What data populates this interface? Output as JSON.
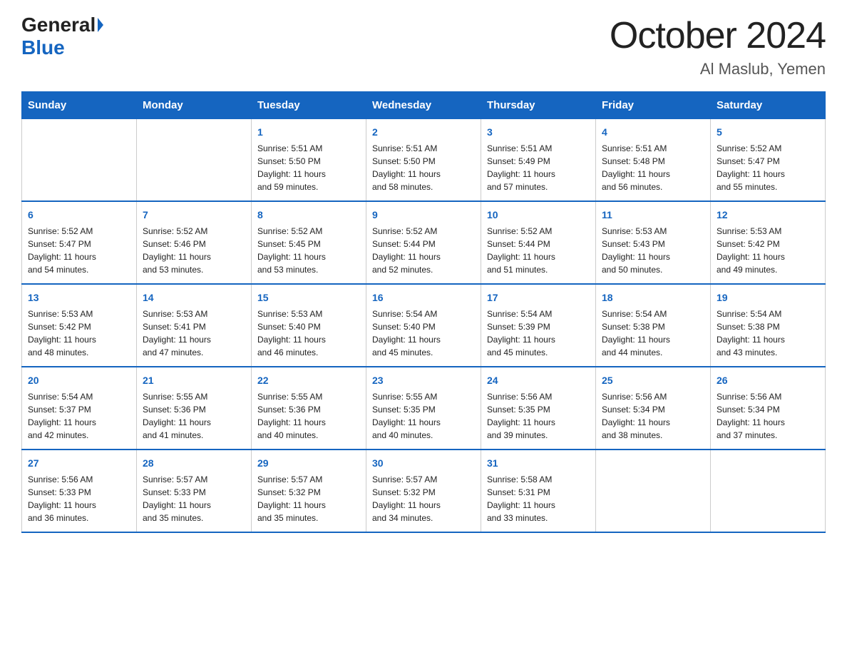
{
  "header": {
    "logo_general": "General",
    "logo_blue": "Blue",
    "title": "October 2024",
    "subtitle": "Al Maslub, Yemen"
  },
  "weekdays": [
    "Sunday",
    "Monday",
    "Tuesday",
    "Wednesday",
    "Thursday",
    "Friday",
    "Saturday"
  ],
  "weeks": [
    [
      {
        "day": "",
        "info": ""
      },
      {
        "day": "",
        "info": ""
      },
      {
        "day": "1",
        "info": "Sunrise: 5:51 AM\nSunset: 5:50 PM\nDaylight: 11 hours\nand 59 minutes."
      },
      {
        "day": "2",
        "info": "Sunrise: 5:51 AM\nSunset: 5:50 PM\nDaylight: 11 hours\nand 58 minutes."
      },
      {
        "day": "3",
        "info": "Sunrise: 5:51 AM\nSunset: 5:49 PM\nDaylight: 11 hours\nand 57 minutes."
      },
      {
        "day": "4",
        "info": "Sunrise: 5:51 AM\nSunset: 5:48 PM\nDaylight: 11 hours\nand 56 minutes."
      },
      {
        "day": "5",
        "info": "Sunrise: 5:52 AM\nSunset: 5:47 PM\nDaylight: 11 hours\nand 55 minutes."
      }
    ],
    [
      {
        "day": "6",
        "info": "Sunrise: 5:52 AM\nSunset: 5:47 PM\nDaylight: 11 hours\nand 54 minutes."
      },
      {
        "day": "7",
        "info": "Sunrise: 5:52 AM\nSunset: 5:46 PM\nDaylight: 11 hours\nand 53 minutes."
      },
      {
        "day": "8",
        "info": "Sunrise: 5:52 AM\nSunset: 5:45 PM\nDaylight: 11 hours\nand 53 minutes."
      },
      {
        "day": "9",
        "info": "Sunrise: 5:52 AM\nSunset: 5:44 PM\nDaylight: 11 hours\nand 52 minutes."
      },
      {
        "day": "10",
        "info": "Sunrise: 5:52 AM\nSunset: 5:44 PM\nDaylight: 11 hours\nand 51 minutes."
      },
      {
        "day": "11",
        "info": "Sunrise: 5:53 AM\nSunset: 5:43 PM\nDaylight: 11 hours\nand 50 minutes."
      },
      {
        "day": "12",
        "info": "Sunrise: 5:53 AM\nSunset: 5:42 PM\nDaylight: 11 hours\nand 49 minutes."
      }
    ],
    [
      {
        "day": "13",
        "info": "Sunrise: 5:53 AM\nSunset: 5:42 PM\nDaylight: 11 hours\nand 48 minutes."
      },
      {
        "day": "14",
        "info": "Sunrise: 5:53 AM\nSunset: 5:41 PM\nDaylight: 11 hours\nand 47 minutes."
      },
      {
        "day": "15",
        "info": "Sunrise: 5:53 AM\nSunset: 5:40 PM\nDaylight: 11 hours\nand 46 minutes."
      },
      {
        "day": "16",
        "info": "Sunrise: 5:54 AM\nSunset: 5:40 PM\nDaylight: 11 hours\nand 45 minutes."
      },
      {
        "day": "17",
        "info": "Sunrise: 5:54 AM\nSunset: 5:39 PM\nDaylight: 11 hours\nand 45 minutes."
      },
      {
        "day": "18",
        "info": "Sunrise: 5:54 AM\nSunset: 5:38 PM\nDaylight: 11 hours\nand 44 minutes."
      },
      {
        "day": "19",
        "info": "Sunrise: 5:54 AM\nSunset: 5:38 PM\nDaylight: 11 hours\nand 43 minutes."
      }
    ],
    [
      {
        "day": "20",
        "info": "Sunrise: 5:54 AM\nSunset: 5:37 PM\nDaylight: 11 hours\nand 42 minutes."
      },
      {
        "day": "21",
        "info": "Sunrise: 5:55 AM\nSunset: 5:36 PM\nDaylight: 11 hours\nand 41 minutes."
      },
      {
        "day": "22",
        "info": "Sunrise: 5:55 AM\nSunset: 5:36 PM\nDaylight: 11 hours\nand 40 minutes."
      },
      {
        "day": "23",
        "info": "Sunrise: 5:55 AM\nSunset: 5:35 PM\nDaylight: 11 hours\nand 40 minutes."
      },
      {
        "day": "24",
        "info": "Sunrise: 5:56 AM\nSunset: 5:35 PM\nDaylight: 11 hours\nand 39 minutes."
      },
      {
        "day": "25",
        "info": "Sunrise: 5:56 AM\nSunset: 5:34 PM\nDaylight: 11 hours\nand 38 minutes."
      },
      {
        "day": "26",
        "info": "Sunrise: 5:56 AM\nSunset: 5:34 PM\nDaylight: 11 hours\nand 37 minutes."
      }
    ],
    [
      {
        "day": "27",
        "info": "Sunrise: 5:56 AM\nSunset: 5:33 PM\nDaylight: 11 hours\nand 36 minutes."
      },
      {
        "day": "28",
        "info": "Sunrise: 5:57 AM\nSunset: 5:33 PM\nDaylight: 11 hours\nand 35 minutes."
      },
      {
        "day": "29",
        "info": "Sunrise: 5:57 AM\nSunset: 5:32 PM\nDaylight: 11 hours\nand 35 minutes."
      },
      {
        "day": "30",
        "info": "Sunrise: 5:57 AM\nSunset: 5:32 PM\nDaylight: 11 hours\nand 34 minutes."
      },
      {
        "day": "31",
        "info": "Sunrise: 5:58 AM\nSunset: 5:31 PM\nDaylight: 11 hours\nand 33 minutes."
      },
      {
        "day": "",
        "info": ""
      },
      {
        "day": "",
        "info": ""
      }
    ]
  ]
}
